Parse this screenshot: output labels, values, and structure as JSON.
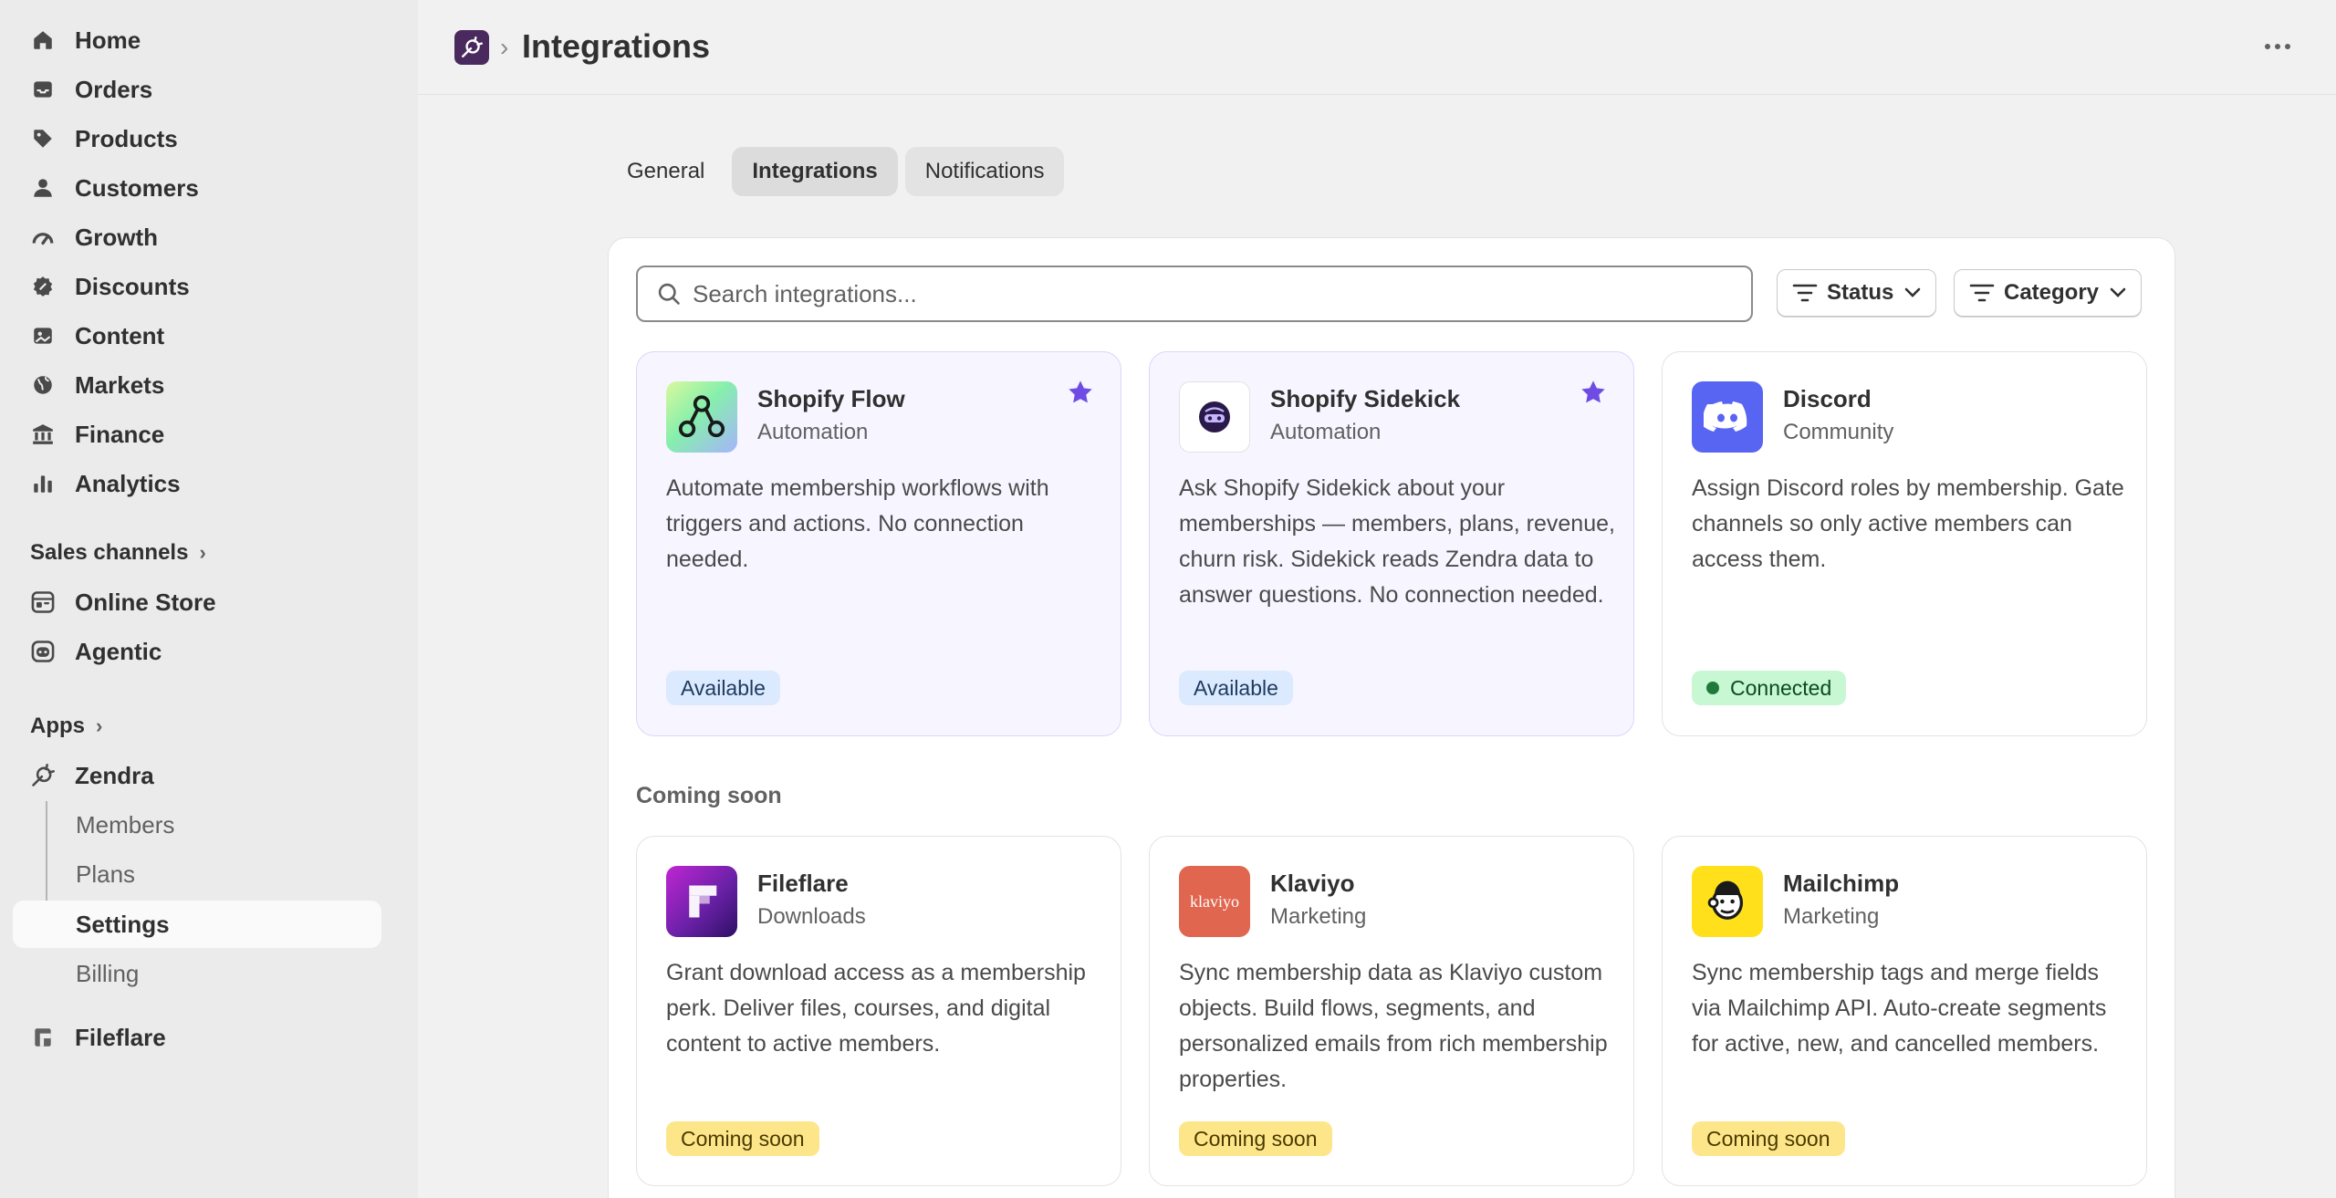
{
  "sidebar": {
    "nav": [
      {
        "label": "Home",
        "icon": "home-icon"
      },
      {
        "label": "Orders",
        "icon": "inbox-icon"
      },
      {
        "label": "Products",
        "icon": "tag-icon"
      },
      {
        "label": "Customers",
        "icon": "person-icon"
      },
      {
        "label": "Growth",
        "icon": "gauge-icon"
      },
      {
        "label": "Discounts",
        "icon": "discount-icon"
      },
      {
        "label": "Content",
        "icon": "image-icon"
      },
      {
        "label": "Markets",
        "icon": "globe-icon"
      },
      {
        "label": "Finance",
        "icon": "bank-icon"
      },
      {
        "label": "Analytics",
        "icon": "bar-chart-icon"
      }
    ],
    "sales_channels": {
      "heading": "Sales channels",
      "items": [
        {
          "label": "Online Store",
          "icon": "store-icon"
        },
        {
          "label": "Agentic",
          "icon": "robot-icon"
        }
      ]
    },
    "apps": {
      "heading": "Apps",
      "zendra": {
        "label": "Zendra",
        "icon": "zendra-icon"
      },
      "sub_items": [
        {
          "label": "Members"
        },
        {
          "label": "Plans"
        },
        {
          "label": "Settings"
        },
        {
          "label": "Billing"
        }
      ],
      "fileflare": {
        "label": "Fileflare",
        "icon": "fileflare-icon"
      }
    }
  },
  "header": {
    "breadcrumb_separator": "›",
    "title": "Integrations"
  },
  "tabs": [
    {
      "label": "General"
    },
    {
      "label": "Integrations"
    },
    {
      "label": "Notifications"
    }
  ],
  "search": {
    "placeholder": "Search integrations..."
  },
  "filters": {
    "status": "Status",
    "category": "Category"
  },
  "integrations": [
    {
      "name": "Shopify Flow",
      "category": "Automation",
      "description": "Automate membership workflows with triggers and actions. No connection needed.",
      "status": "Available",
      "starred": true
    },
    {
      "name": "Shopify Sidekick",
      "category": "Automation",
      "description": "Ask Shopify Sidekick about your memberships — members, plans, revenue, churn risk. Sidekick reads Zendra data to answer questions. No connection needed.",
      "status": "Available",
      "starred": true
    },
    {
      "name": "Discord",
      "category": "Community",
      "description": "Assign Discord roles by membership. Gate channels so only active members can access them.",
      "status": "Connected",
      "starred": false
    }
  ],
  "coming_soon": {
    "heading": "Coming soon",
    "items": [
      {
        "name": "Fileflare",
        "category": "Downloads",
        "description": "Grant download access as a membership perk. Deliver files, courses, and digital content to active members.",
        "status": "Coming soon"
      },
      {
        "name": "Klaviyo",
        "category": "Marketing",
        "description": "Sync membership data as Klaviyo custom objects. Build flows, segments, and personalized emails from rich membership properties.",
        "status": "Coming soon",
        "logo_text": "klaviyo"
      },
      {
        "name": "Mailchimp",
        "category": "Marketing",
        "description": "Sync membership tags and merge fields via Mailchimp API. Auto-create segments for active, new, and cancelled members.",
        "status": "Coming soon"
      }
    ]
  },
  "colors": {
    "accent": "#6e4ce4",
    "discord": "#5865f2",
    "klaviyo": "#e0664f",
    "mailchimp": "#ffe01b",
    "connected": "#1f7a3a"
  }
}
